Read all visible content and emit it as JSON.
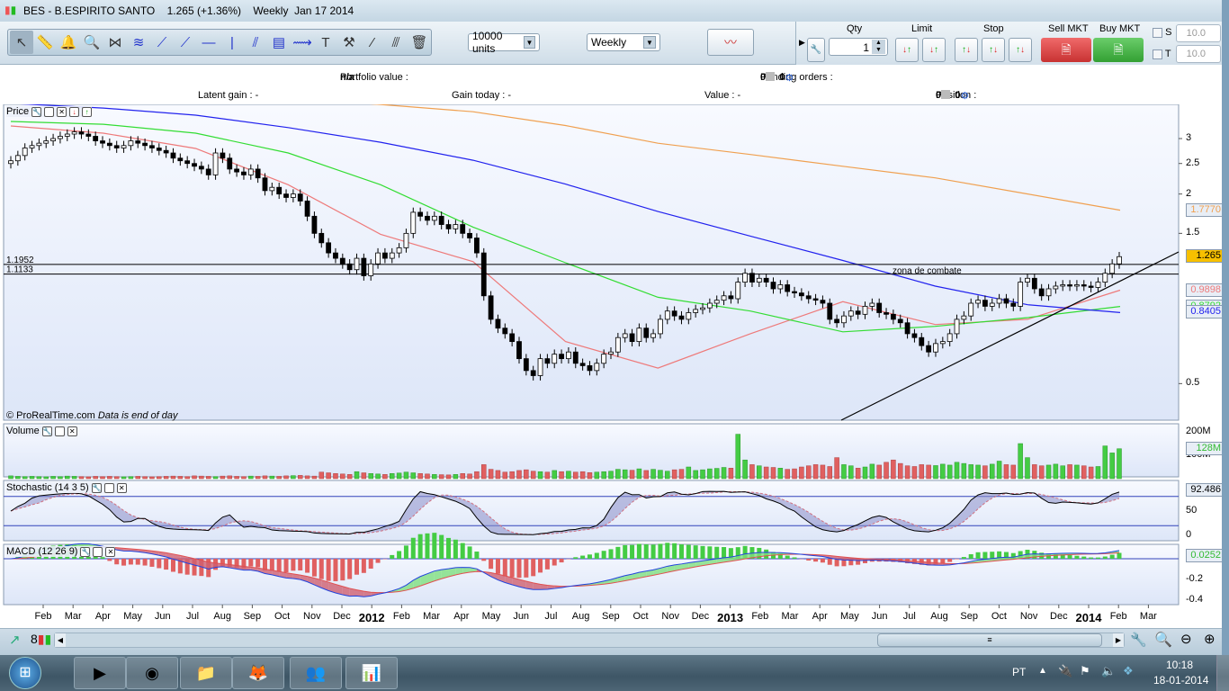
{
  "window": {
    "title": "BES - B.ESPIRITO SANTO    1.265 (+1.36%)    Weekly  Jan 17 2014"
  },
  "toolbar": {
    "tools": [
      "pointer-icon",
      "ruler-icon",
      "alarm-bell-icon",
      "zoom-icon",
      "fibonacci-fan-icon",
      "fibonacci-retracement-icon",
      "segment-icon",
      "line-icon",
      "horizontal-line-icon",
      "vertical-line-icon",
      "parallel-channel-icon",
      "regression-channel-icon",
      "trend-channel-icon",
      "text-icon",
      "properties-tools-icon",
      "point-icon",
      "half-line-icon",
      "trash-icon"
    ],
    "units": "10000 units",
    "period": "Weekly"
  },
  "order": {
    "qty_label": "Qty",
    "qty_value": "1",
    "limit_label": "Limit",
    "stop_label": "Stop",
    "sell_label": "Sell MKT",
    "buy_label": "Buy MKT",
    "s_label": "S",
    "t_label": "T",
    "s_value": "10.0",
    "t_value": "10.0"
  },
  "info": {
    "portfolio_label": "Portfolio value : ",
    "portfolio_value": "n/a",
    "pending_label": "Pending orders : ",
    "pending_a": "0",
    "pending_b": "0",
    "latent_label": "Latent gain : -",
    "gain_today_label": "Gain today : -",
    "value_label": "Value : -",
    "position_label": "Position : ",
    "position_a": "0",
    "position_b": "0"
  },
  "panels": {
    "price": "Price",
    "volume": "Volume",
    "stochastic": "Stochastic (14 3 5)",
    "macd": "MACD (12 26 9)",
    "copyright": "© ProRealTime.com",
    "eod": "Data is end of day"
  },
  "price_chart": {
    "scale": "log",
    "ticks": [
      "3",
      "2.5",
      "2",
      "1.5",
      "0.5"
    ],
    "last_price": "1.265",
    "hlines": [
      {
        "value": 1.1952,
        "label": "1.1952"
      },
      {
        "value": 1.1133,
        "label": "1.1133"
      }
    ],
    "annotation": "zona de combate",
    "closes": [
      2.55,
      2.65,
      2.8,
      2.85,
      2.9,
      2.95,
      3.0,
      3.05,
      3.1,
      3.15,
      3.1,
      3.05,
      2.95,
      2.9,
      2.85,
      2.8,
      2.85,
      2.95,
      2.9,
      2.85,
      2.8,
      2.75,
      2.7,
      2.6,
      2.55,
      2.5,
      2.45,
      2.4,
      2.3,
      2.7,
      2.6,
      2.4,
      2.35,
      2.3,
      2.4,
      2.25,
      2.05,
      2.1,
      2.0,
      1.95,
      2.0,
      1.9,
      1.7,
      1.5,
      1.4,
      1.3,
      1.25,
      1.2,
      1.15,
      1.25,
      1.1,
      1.2,
      1.3,
      1.25,
      1.3,
      1.35,
      1.5,
      1.75,
      1.7,
      1.65,
      1.7,
      1.6,
      1.55,
      1.6,
      1.5,
      1.45,
      1.3,
      0.95,
      0.8,
      0.75,
      0.72,
      0.68,
      0.6,
      0.55,
      0.53,
      0.6,
      0.58,
      0.62,
      0.6,
      0.63,
      0.58,
      0.57,
      0.55,
      0.58,
      0.62,
      0.63,
      0.7,
      0.72,
      0.68,
      0.75,
      0.7,
      0.72,
      0.8,
      0.85,
      0.82,
      0.8,
      0.84,
      0.86,
      0.87,
      0.9,
      0.92,
      0.95,
      0.93,
      1.05,
      1.12,
      1.05,
      1.08,
      1.05,
      1.0,
      1.03,
      0.98,
      0.97,
      0.95,
      0.93,
      0.92,
      0.9,
      0.8,
      0.78,
      0.82,
      0.85,
      0.83,
      0.88,
      0.9,
      0.84,
      0.83,
      0.8,
      0.78,
      0.72,
      0.7,
      0.66,
      0.63,
      0.67,
      0.68,
      0.72,
      0.8,
      0.82,
      0.9,
      0.92,
      0.88,
      0.9,
      0.93,
      0.9,
      0.88,
      1.05,
      1.08,
      1.0,
      0.95,
      1.0,
      1.02,
      1.03,
      1.02,
      1.03,
      1.02,
      1.01,
      1.05,
      1.12,
      1.2,
      1.265
    ],
    "moving_averages": [
      {
        "color": "#f0a050",
        "last": "1.7770",
        "values": [
          4.6,
          4.4,
          4.2,
          4.0,
          3.85,
          3.65,
          3.3,
          2.9,
          2.67,
          2.45,
          2.25,
          2.0,
          1.777
        ]
      },
      {
        "color": "#ee7a7a",
        "last": "0.9898",
        "values": [
          3.29,
          3.12,
          2.79,
          2.14,
          1.49,
          1.22,
          0.68,
          0.56,
          0.72,
          0.91,
          0.77,
          0.8,
          0.9898
        ]
      },
      {
        "color": "#33dd33",
        "last": "0.8792",
        "values": [
          3.4,
          3.33,
          3.12,
          2.7,
          2.14,
          1.57,
          1.21,
          0.94,
          0.85,
          0.73,
          0.76,
          0.81,
          0.8792
        ]
      },
      {
        "color": "#2222ee",
        "last": "0.8405",
        "values": [
          3.88,
          3.75,
          3.56,
          3.25,
          2.92,
          2.56,
          2.15,
          1.76,
          1.47,
          1.23,
          1.02,
          0.89,
          0.8405
        ]
      }
    ]
  },
  "volume_chart": {
    "ticks": [
      "200M",
      "100M"
    ],
    "last": "128M",
    "values_M": [
      12,
      10,
      9,
      10,
      9,
      8,
      10,
      9,
      11,
      10,
      9,
      8,
      10,
      9,
      10,
      9,
      8,
      9,
      10,
      9,
      8,
      9,
      10,
      11,
      10,
      9,
      12,
      11,
      10,
      9,
      11,
      12,
      10,
      9,
      11,
      10,
      12,
      11,
      10,
      12,
      13,
      14,
      12,
      11,
      28,
      25,
      22,
      20,
      18,
      30,
      25,
      22,
      20,
      18,
      22,
      24,
      28,
      25,
      22,
      20,
      18,
      17,
      16,
      18,
      22,
      20,
      30,
      60,
      40,
      35,
      28,
      30,
      35,
      38,
      32,
      30,
      28,
      35,
      30,
      32,
      28,
      30,
      26,
      28,
      30,
      32,
      40,
      38,
      36,
      42,
      35,
      40,
      36,
      32,
      38,
      40,
      50,
      35,
      38,
      42,
      44,
      48,
      45,
      190,
      80,
      60,
      55,
      50,
      48,
      45,
      40,
      42,
      50,
      55,
      60,
      58,
      52,
      90,
      60,
      55,
      45,
      50,
      62,
      58,
      70,
      80,
      65,
      55,
      52,
      60,
      58,
      56,
      62,
      58,
      70,
      65,
      60,
      58,
      55,
      62,
      75,
      60,
      58,
      150,
      90,
      60,
      55,
      58,
      62,
      55,
      60,
      58,
      55,
      50,
      52,
      140,
      110,
      128
    ]
  },
  "stochastic_chart": {
    "ticks": [
      "50",
      "0"
    ],
    "last": "92.486",
    "levels": [
      80,
      20
    ]
  },
  "macd_chart": {
    "ticks": [
      "-0.2",
      "-0.4"
    ],
    "last": "0.0252"
  },
  "x_axis": {
    "labels": [
      "Feb",
      "Mar",
      "Apr",
      "May",
      "Jun",
      "Jul",
      "Aug",
      "Sep",
      "Oct",
      "Nov",
      "Dec",
      "2012",
      "Feb",
      "Mar",
      "Apr",
      "May",
      "Jun",
      "Jul",
      "Aug",
      "Sep",
      "Oct",
      "Nov",
      "Dec",
      "2013",
      "Feb",
      "Mar",
      "Apr",
      "May",
      "Jun",
      "Jul",
      "Aug",
      "Sep",
      "Oct",
      "Nov",
      "Dec",
      "2014",
      "Feb",
      "Mar"
    ]
  },
  "taskbar": {
    "apps": [
      "media-player-icon",
      "chrome-icon",
      "explorer-folder-icon",
      "firefox-icon",
      "messenger-icon",
      "prorealtime-icon"
    ],
    "language": "PT",
    "time": "10:18",
    "date": "18-01-2014"
  }
}
